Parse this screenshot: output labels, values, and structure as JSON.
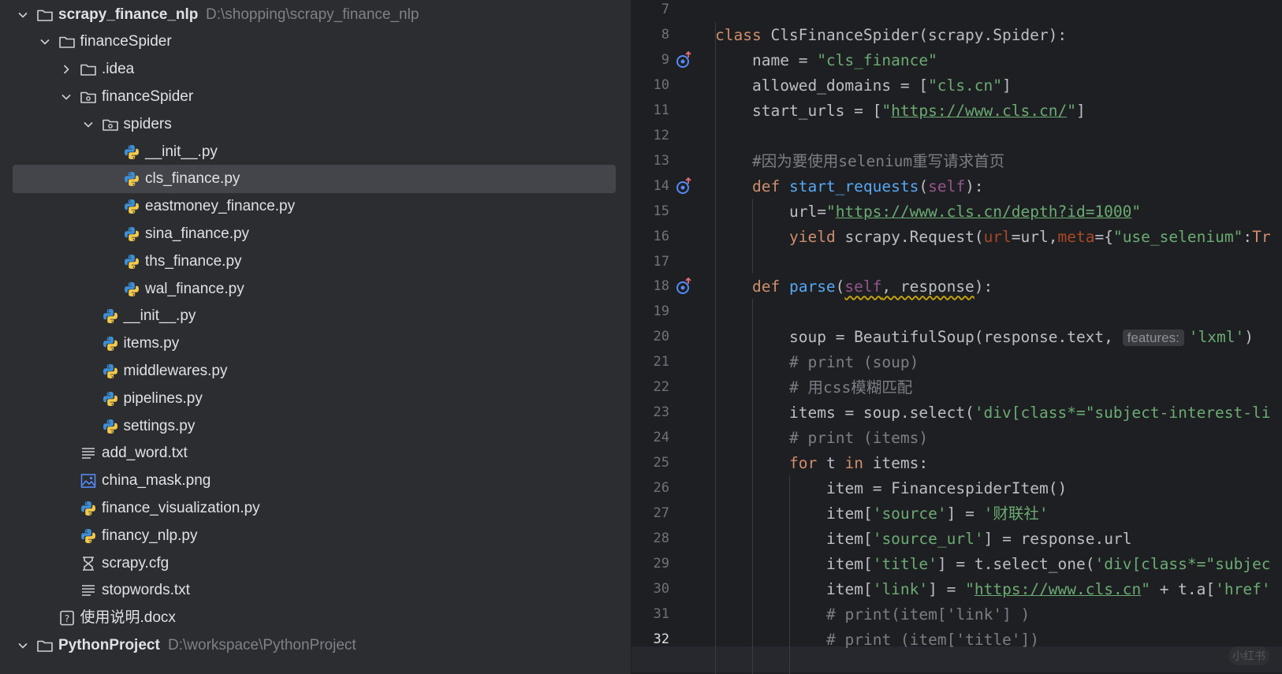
{
  "project_tree": {
    "items": [
      {
        "name": "scrapy_finance_nlp",
        "path": "D:\\shopping\\scrapy_finance_nlp",
        "level": 0,
        "type": "folder",
        "expanded": true,
        "bold": true,
        "icon": "folder-icon"
      },
      {
        "name": "financeSpider",
        "level": 1,
        "type": "folder",
        "expanded": true,
        "icon": "folder-icon"
      },
      {
        "name": ".idea",
        "level": 2,
        "type": "folder",
        "expanded": false,
        "icon": "folder-icon"
      },
      {
        "name": "financeSpider",
        "level": 2,
        "type": "package",
        "expanded": true,
        "icon": "package-folder-icon"
      },
      {
        "name": "spiders",
        "level": 3,
        "type": "package",
        "expanded": true,
        "icon": "package-folder-icon"
      },
      {
        "name": "__init__.py",
        "level": 4,
        "type": "python",
        "icon": "python-file-icon"
      },
      {
        "name": "cls_finance.py",
        "level": 4,
        "type": "python",
        "selected": true,
        "icon": "python-file-icon"
      },
      {
        "name": "eastmoney_finance.py",
        "level": 4,
        "type": "python",
        "icon": "python-file-icon"
      },
      {
        "name": "sina_finance.py",
        "level": 4,
        "type": "python",
        "icon": "python-file-icon"
      },
      {
        "name": "ths_finance.py",
        "level": 4,
        "type": "python",
        "icon": "python-file-icon"
      },
      {
        "name": "wal_finance.py",
        "level": 4,
        "type": "python",
        "icon": "python-file-icon"
      },
      {
        "name": "__init__.py",
        "level": 3,
        "type": "python",
        "icon": "python-file-icon"
      },
      {
        "name": "items.py",
        "level": 3,
        "type": "python",
        "icon": "python-file-icon"
      },
      {
        "name": "middlewares.py",
        "level": 3,
        "type": "python",
        "icon": "python-file-icon"
      },
      {
        "name": "pipelines.py",
        "level": 3,
        "type": "python",
        "icon": "python-file-icon"
      },
      {
        "name": "settings.py",
        "level": 3,
        "type": "python",
        "icon": "python-file-icon"
      },
      {
        "name": "add_word.txt",
        "level": 2,
        "type": "text",
        "icon": "text-file-icon"
      },
      {
        "name": "china_mask.png",
        "level": 2,
        "type": "image",
        "icon": "image-file-icon"
      },
      {
        "name": "finance_visualization.py",
        "level": 2,
        "type": "python",
        "icon": "python-file-icon"
      },
      {
        "name": "financy_nlp.py",
        "level": 2,
        "type": "python",
        "icon": "python-file-icon"
      },
      {
        "name": "scrapy.cfg",
        "level": 2,
        "type": "config",
        "icon": "config-file-icon"
      },
      {
        "name": "stopwords.txt",
        "level": 2,
        "type": "text",
        "icon": "text-file-icon"
      },
      {
        "name": "使用说明.docx",
        "level": 1,
        "type": "unknown",
        "icon": "unknown-file-icon"
      },
      {
        "name": "PythonProject",
        "path": "D:\\workspace\\PythonProject",
        "level": 0,
        "type": "folder",
        "expanded": true,
        "bold": true,
        "icon": "folder-icon"
      }
    ]
  },
  "editor": {
    "current_line": 32,
    "lines": [
      {
        "n": 7,
        "indent": 0,
        "tokens": []
      },
      {
        "n": 8,
        "indent": 0,
        "tokens": [
          {
            "t": "class ",
            "c": "kw"
          },
          {
            "t": "ClsFinanceSpider(scrapy.Spider):",
            "c": ""
          }
        ]
      },
      {
        "n": 9,
        "indent": 1,
        "gutter": "override-icon",
        "tokens": [
          {
            "t": "name = ",
            "c": ""
          },
          {
            "t": "\"cls_finance\"",
            "c": "str"
          }
        ]
      },
      {
        "n": 10,
        "indent": 1,
        "tokens": [
          {
            "t": "allowed_domains = [",
            "c": ""
          },
          {
            "t": "\"cls.cn\"",
            "c": "str"
          },
          {
            "t": "]",
            "c": ""
          }
        ]
      },
      {
        "n": 11,
        "indent": 1,
        "tokens": [
          {
            "t": "start_urls = [",
            "c": ""
          },
          {
            "t": "\"",
            "c": "str"
          },
          {
            "t": "https://www.cls.cn/",
            "c": "str url"
          },
          {
            "t": "\"",
            "c": "str"
          },
          {
            "t": "]",
            "c": ""
          }
        ]
      },
      {
        "n": 12,
        "indent": 0,
        "tokens": []
      },
      {
        "n": 13,
        "indent": 1,
        "tokens": [
          {
            "t": "#因为要使用selenium重写请求首页",
            "c": "cm"
          }
        ]
      },
      {
        "n": 14,
        "indent": 1,
        "gutter": "override-icon",
        "tokens": [
          {
            "t": "def ",
            "c": "kw"
          },
          {
            "t": "start_requests",
            "c": "fn"
          },
          {
            "t": "(",
            "c": ""
          },
          {
            "t": "self",
            "c": "slf"
          },
          {
            "t": "):",
            "c": ""
          }
        ]
      },
      {
        "n": 15,
        "indent": 2,
        "tokens": [
          {
            "t": "url=",
            "c": ""
          },
          {
            "t": "\"",
            "c": "str"
          },
          {
            "t": "https://www.cls.cn/depth?id=1000",
            "c": "str url"
          },
          {
            "t": "\"",
            "c": "str"
          }
        ]
      },
      {
        "n": 16,
        "indent": 2,
        "tokens": [
          {
            "t": "yield ",
            "c": "kw"
          },
          {
            "t": "scrapy.Request(",
            "c": ""
          },
          {
            "t": "url",
            "c": "prm"
          },
          {
            "t": "=url,",
            "c": ""
          },
          {
            "t": "meta",
            "c": "prm"
          },
          {
            "t": "={",
            "c": ""
          },
          {
            "t": "\"use_selenium\"",
            "c": "str"
          },
          {
            "t": ":",
            "c": ""
          },
          {
            "t": "Tr",
            "c": "kw"
          }
        ]
      },
      {
        "n": 17,
        "indent": 0,
        "tokens": []
      },
      {
        "n": 18,
        "indent": 1,
        "gutter": "override-icon",
        "tokens": [
          {
            "t": "def ",
            "c": "kw"
          },
          {
            "t": "parse",
            "c": "fn"
          },
          {
            "t": "(",
            "c": ""
          },
          {
            "t": "self",
            "c": "slf squig"
          },
          {
            "t": ", response",
            "c": "squig"
          },
          {
            "t": "):",
            "c": ""
          }
        ]
      },
      {
        "n": 19,
        "indent": 0,
        "tokens": []
      },
      {
        "n": 20,
        "indent": 2,
        "tokens": [
          {
            "t": "soup = BeautifulSoup(response.text, ",
            "c": ""
          },
          {
            "t": "features:",
            "c": "hint"
          },
          {
            "t": "'lxml'",
            "c": "str"
          },
          {
            "t": ")",
            "c": ""
          }
        ]
      },
      {
        "n": 21,
        "indent": 2,
        "tokens": [
          {
            "t": "# print (soup)",
            "c": "cm"
          }
        ]
      },
      {
        "n": 22,
        "indent": 2,
        "tokens": [
          {
            "t": "# 用css模糊匹配",
            "c": "cm"
          }
        ]
      },
      {
        "n": 23,
        "indent": 2,
        "tokens": [
          {
            "t": "items = soup.select(",
            "c": ""
          },
          {
            "t": "'div[class*=\"subject-interest-li",
            "c": "str"
          }
        ]
      },
      {
        "n": 24,
        "indent": 2,
        "tokens": [
          {
            "t": "# print (items)",
            "c": "cm"
          }
        ]
      },
      {
        "n": 25,
        "indent": 2,
        "tokens": [
          {
            "t": "for ",
            "c": "kw"
          },
          {
            "t": "t ",
            "c": ""
          },
          {
            "t": "in ",
            "c": "kw"
          },
          {
            "t": "items:",
            "c": ""
          }
        ]
      },
      {
        "n": 26,
        "indent": 3,
        "tokens": [
          {
            "t": "item = FinancespiderItem()",
            "c": ""
          }
        ]
      },
      {
        "n": 27,
        "indent": 3,
        "tokens": [
          {
            "t": "item[",
            "c": ""
          },
          {
            "t": "'source'",
            "c": "str"
          },
          {
            "t": "] = ",
            "c": ""
          },
          {
            "t": "'财联社'",
            "c": "str"
          }
        ]
      },
      {
        "n": 28,
        "indent": 3,
        "tokens": [
          {
            "t": "item[",
            "c": ""
          },
          {
            "t": "'source_url'",
            "c": "str"
          },
          {
            "t": "] = response.url",
            "c": ""
          }
        ]
      },
      {
        "n": 29,
        "indent": 3,
        "tokens": [
          {
            "t": "item[",
            "c": ""
          },
          {
            "t": "'title'",
            "c": "str"
          },
          {
            "t": "] = t.select_one(",
            "c": ""
          },
          {
            "t": "'div[class*=\"subjec",
            "c": "str"
          }
        ]
      },
      {
        "n": 30,
        "indent": 3,
        "tokens": [
          {
            "t": "item[",
            "c": ""
          },
          {
            "t": "'link'",
            "c": "str"
          },
          {
            "t": "] = ",
            "c": ""
          },
          {
            "t": "\"",
            "c": "str"
          },
          {
            "t": "https://www.cls.cn",
            "c": "str url"
          },
          {
            "t": "\"",
            "c": "str"
          },
          {
            "t": " + t.a[",
            "c": ""
          },
          {
            "t": "'href'",
            "c": "str"
          }
        ]
      },
      {
        "n": 31,
        "indent": 3,
        "tokens": [
          {
            "t": "# print(item['link'] )",
            "c": "cm"
          }
        ]
      },
      {
        "n": 32,
        "indent": 3,
        "tokens": [
          {
            "t": "# print (item['title'])",
            "c": "cm"
          }
        ]
      }
    ]
  },
  "watermark": "小红书",
  "colors": {
    "tree_bg": "#2b2d30",
    "editor_bg": "#1e1f22",
    "selected_row": "#43454a",
    "keyword": "#cf8e6d",
    "string": "#6aab73",
    "comment": "#7a7e85",
    "function": "#56a8f5",
    "self": "#94558d",
    "param": "#aa4926"
  }
}
